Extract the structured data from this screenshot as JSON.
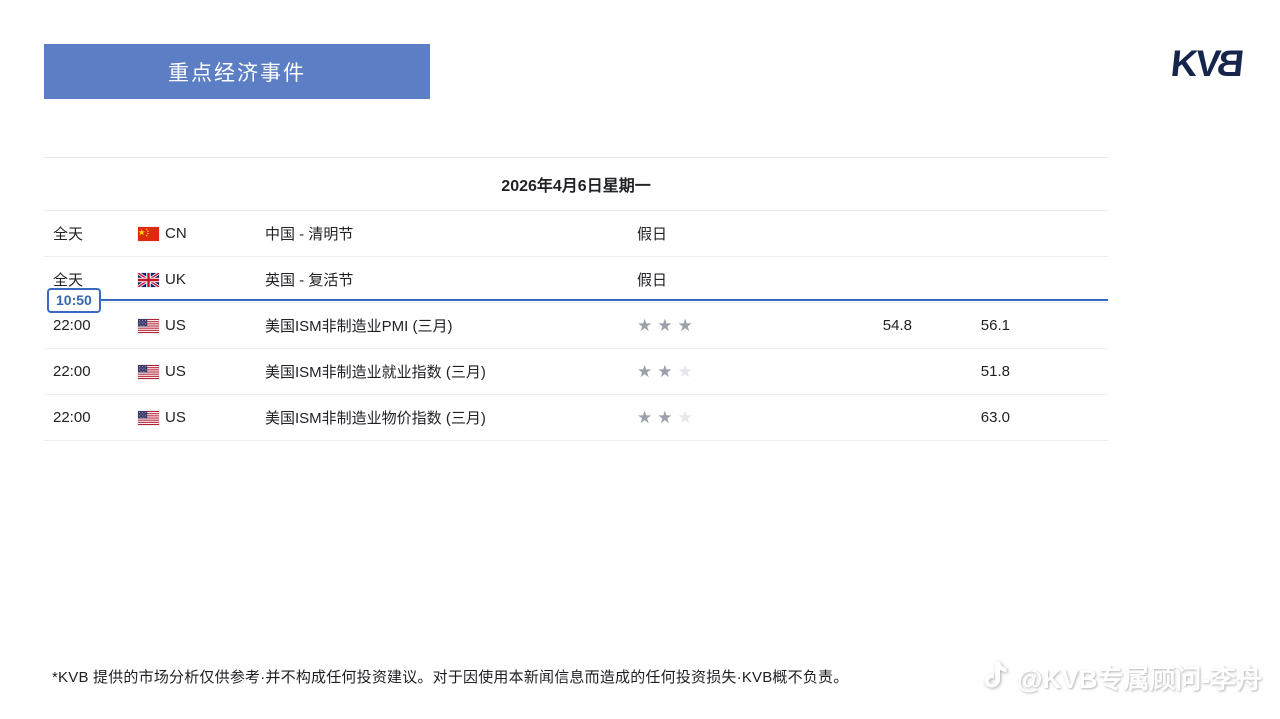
{
  "page": {
    "title_banner": "重点经济事件",
    "logo_kv": "KV",
    "logo_b": "B",
    "date_header": "2026年4月6日星期一",
    "time_marker": "10:50",
    "disclaimer": "*KVB 提供的市场分析仅供参考·并不构成任何投资建议。对于因使用本新闻信息而造成的任何投资损失·KVB概不负责。",
    "watermark": "@KVB专属顾问-李舟"
  },
  "icons": {
    "watermark_icon": "douyin-note-icon",
    "flag_icons": [
      "cn-flag-icon",
      "uk-flag-icon",
      "us-flag-icon"
    ],
    "star_glyph": "★",
    "stars_max": 3
  },
  "colors": {
    "banner_blue": "#5b7ec4",
    "logo_navy": "#16254c",
    "marker_blue": "#3a6abf",
    "star_filled": "#9aa1ab",
    "star_empty": "#e3e6ea",
    "divider": "#ecedf0"
  },
  "calendar": {
    "rows": [
      {
        "time": "全天",
        "flag": "cn",
        "country": "CN",
        "event": "中国 - 清明节",
        "importance_text": "假日",
        "stars": null,
        "value1": "",
        "value2": ""
      },
      {
        "time": "全天",
        "flag": "uk",
        "country": "UK",
        "event": "英国 - 复活节",
        "importance_text": "假日",
        "stars": null,
        "value1": "",
        "value2": ""
      },
      {
        "time": "22:00",
        "flag": "us",
        "country": "US",
        "event": "美国ISM非制造业PMI (三月)",
        "importance_text": null,
        "stars": 3,
        "value1": "54.8",
        "value2": "56.1"
      },
      {
        "time": "22:00",
        "flag": "us",
        "country": "US",
        "event": "美国ISM非制造业就业指数 (三月)",
        "importance_text": null,
        "stars": 2,
        "value1": "",
        "value2": "51.8"
      },
      {
        "time": "22:00",
        "flag": "us",
        "country": "US",
        "event": "美国ISM非制造业物价指数 (三月)",
        "importance_text": null,
        "stars": 2,
        "value1": "",
        "value2": "63.0"
      }
    ]
  }
}
